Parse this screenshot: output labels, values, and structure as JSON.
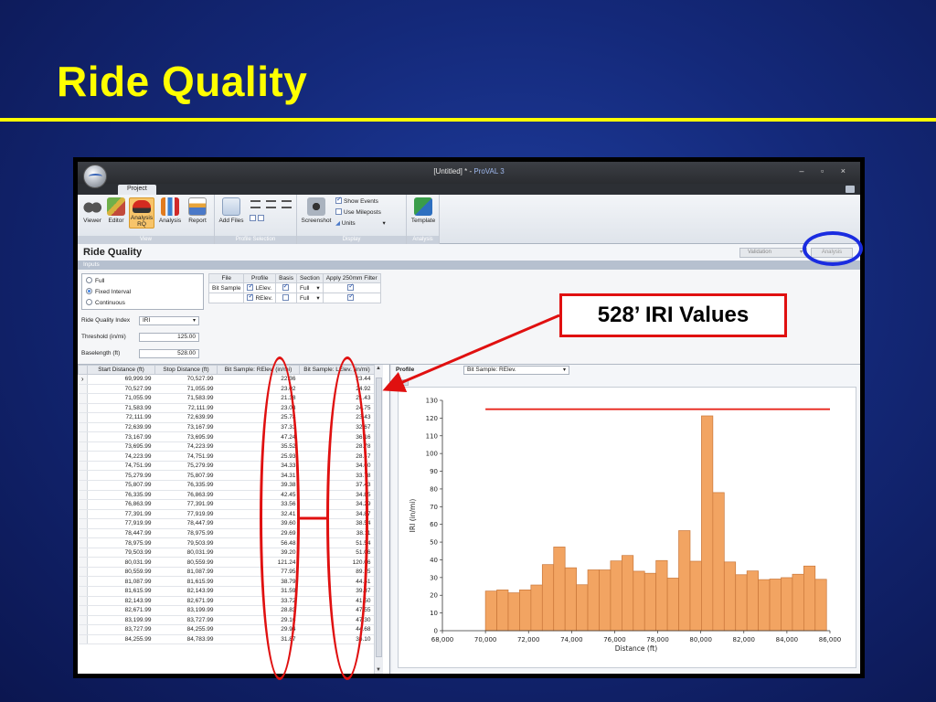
{
  "slide": {
    "title": "Ride Quality",
    "callout": "528’ IRI Values"
  },
  "colors": {
    "title": "#ffff00",
    "annotation_red": "#e01010",
    "annotation_blue": "#1a2ce0",
    "bar_fill": "#f2a462",
    "bar_stroke": "#c9773a",
    "threshold_line": "#e8261c"
  },
  "window": {
    "title": "[Untitled] * - ",
    "brand": "ProVAL 3",
    "controls": "– ▫ ×",
    "tab": "Project"
  },
  "ribbon": {
    "buttons": [
      {
        "label": "Viewer",
        "icon": "binoculars-icon"
      },
      {
        "label": "Editor",
        "icon": "editor-icon"
      },
      {
        "label": "Analysis RQ",
        "icon": "car-icon"
      },
      {
        "label": "Analysis",
        "icon": "bar-chart-icon"
      },
      {
        "label": "Report",
        "icon": "report-icon"
      },
      {
        "label": "Add Files",
        "icon": "add-file-icon"
      },
      {
        "label": "Screenshot",
        "icon": "camera-icon"
      },
      {
        "label": "Template",
        "icon": "template-icon"
      }
    ],
    "groups": {
      "view": "View",
      "profile_selection": "Profile Selection",
      "display": "Display",
      "analysis": "Analysis"
    },
    "display_options": [
      {
        "label": "Show Events",
        "checked": true
      },
      {
        "label": "Use Mileposts",
        "checked": false
      },
      {
        "label": "Units",
        "checked": false
      }
    ]
  },
  "pane": {
    "title": "Ride Quality",
    "validation_label": "Validation",
    "analysis_label": "Analysis",
    "inputs_label": "Inputs"
  },
  "inputs": {
    "interval_options": [
      {
        "label": "Full",
        "selected": false
      },
      {
        "label": "Fixed Interval",
        "selected": true
      },
      {
        "label": "Continuous",
        "selected": false
      }
    ],
    "ride_quality_index_label": "Ride Quality Index",
    "ride_quality_index_value": "IRI",
    "threshold_label": "Threshold (in/mi)",
    "threshold_value": "125.00",
    "baselength_label": "Baselength (ft)",
    "baselength_value": "528.00"
  },
  "files_table": {
    "headers": [
      "File",
      "Profile",
      "Basis",
      "Section",
      "Apply 250mm Filter"
    ],
    "rows": [
      {
        "file": "Bit Sample",
        "profile": "LElev.",
        "basis": true,
        "section": "Full",
        "filter": true
      },
      {
        "file": "",
        "profile": "RElev.",
        "basis": false,
        "section": "Full",
        "filter": true
      }
    ]
  },
  "grid": {
    "headers": [
      "Start Distance (ft)",
      "Stop Distance (ft)",
      "Bit Sample: RElev. (in/mi)",
      "Bit Sample: LElev. (in/mi)"
    ],
    "rows": [
      [
        "69,999.99",
        "70,527.99",
        "22.36",
        "23.44"
      ],
      [
        "70,527.99",
        "71,055.99",
        "23.02",
        "24.92"
      ],
      [
        "71,055.99",
        "71,583.99",
        "21.38",
        "21.43"
      ],
      [
        "71,583.99",
        "72,111.99",
        "23.03",
        "24.75"
      ],
      [
        "72,111.99",
        "72,639.99",
        "25.78",
        "23.43"
      ],
      [
        "72,639.99",
        "73,167.99",
        "37.31",
        "32.67"
      ],
      [
        "73,167.99",
        "73,695.99",
        "47.24",
        "36.16"
      ],
      [
        "73,695.99",
        "74,223.99",
        "35.52",
        "28.78"
      ],
      [
        "74,223.99",
        "74,751.99",
        "25.93",
        "28.47"
      ],
      [
        "74,751.99",
        "75,279.99",
        "34.33",
        "34.00"
      ],
      [
        "75,279.99",
        "75,807.99",
        "34.31",
        "33.78"
      ],
      [
        "75,807.99",
        "76,335.99",
        "39.38",
        "37.43"
      ],
      [
        "76,335.99",
        "76,863.99",
        "42.45",
        "34.85"
      ],
      [
        "76,863.99",
        "77,391.99",
        "33.56",
        "34.29"
      ],
      [
        "77,391.99",
        "77,919.99",
        "32.41",
        "34.87"
      ],
      [
        "77,919.99",
        "78,447.99",
        "39.60",
        "38.54"
      ],
      [
        "78,447.99",
        "78,975.99",
        "29.69",
        "38.11"
      ],
      [
        "78,975.99",
        "79,503.99",
        "56.48",
        "51.54"
      ],
      [
        "79,503.99",
        "80,031.99",
        "39.20",
        "51.06"
      ],
      [
        "80,031.99",
        "80,559.99",
        "121.24",
        "120.06"
      ],
      [
        "80,559.99",
        "81,087.99",
        "77.95",
        "89.15"
      ],
      [
        "81,087.99",
        "81,615.99",
        "38.79",
        "44.51"
      ],
      [
        "81,615.99",
        "82,143.99",
        "31.59",
        "39.87"
      ],
      [
        "82,143.99",
        "82,671.99",
        "33.72",
        "41.50"
      ],
      [
        "82,671.99",
        "83,199.99",
        "28.83",
        "47.55"
      ],
      [
        "83,199.99",
        "83,727.99",
        "29.16",
        "47.30"
      ],
      [
        "83,727.99",
        "84,255.99",
        "29.94",
        "44.68"
      ],
      [
        "84,255.99",
        "84,783.99",
        "31.87",
        "36.10"
      ]
    ]
  },
  "profile": {
    "label": "Profile",
    "selected": "Bit Sample: RElev."
  },
  "chart_data": {
    "type": "bar",
    "xlabel": "Distance (ft)",
    "ylabel": "IRI (in/mi)",
    "xlim": [
      68000,
      86000
    ],
    "ylim": [
      0,
      130
    ],
    "xticks": [
      68000,
      70000,
      72000,
      74000,
      76000,
      78000,
      80000,
      82000,
      84000,
      86000
    ],
    "xtick_labels": [
      "68,000",
      "70,000",
      "72,000",
      "74,000",
      "76,000",
      "78,000",
      "80,000",
      "82,000",
      "84,000",
      "86,000"
    ],
    "yticks": [
      0,
      10,
      20,
      30,
      40,
      50,
      60,
      70,
      80,
      90,
      100,
      110,
      120,
      130
    ],
    "bar_width": 528,
    "x": [
      70000,
      70528,
      71056,
      71584,
      72112,
      72640,
      73168,
      73696,
      74224,
      74752,
      75280,
      75808,
      76336,
      76864,
      77392,
      77920,
      78448,
      78976,
      79504,
      80032,
      80560,
      81088,
      81616,
      82144,
      82672,
      83200,
      83728,
      84256,
      84784,
      85312
    ],
    "values": [
      22.36,
      23.02,
      21.38,
      23.03,
      25.78,
      37.31,
      47.24,
      35.52,
      25.93,
      34.33,
      34.31,
      39.38,
      42.45,
      33.56,
      32.41,
      39.6,
      29.69,
      56.48,
      39.2,
      121.24,
      77.95,
      38.79,
      31.59,
      33.72,
      28.83,
      29.16,
      29.94,
      31.87,
      36.5,
      29.0
    ],
    "threshold": {
      "value": 125,
      "x_start": 70000,
      "x_end": 86000
    },
    "grid": false,
    "legend": "none"
  }
}
